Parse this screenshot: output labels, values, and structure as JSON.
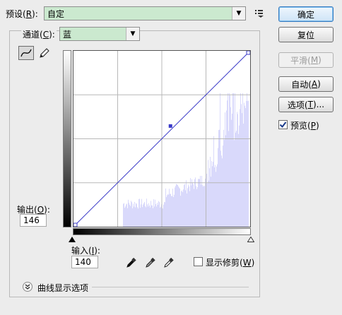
{
  "preset": {
    "label": "预设(",
    "key": "R",
    "suffix": "):",
    "value": "自定"
  },
  "channel": {
    "label": "通道(",
    "key": "C",
    "suffix": "):",
    "value": "蓝"
  },
  "output": {
    "label": "输出(",
    "key": "O",
    "suffix": "):",
    "value": "146"
  },
  "input": {
    "label": "输入(",
    "key": "I",
    "suffix": "):",
    "value": "140"
  },
  "buttons": {
    "ok": "确定",
    "reset": "复位",
    "smooth_pre": "平滑(",
    "smooth_key": "M",
    "smooth_post": ")",
    "auto_pre": "自动(",
    "auto_key": "A",
    "auto_post": ")",
    "options_pre": "选项(",
    "options_key": "T",
    "options_post": ")..."
  },
  "preview": {
    "label_pre": "预览(",
    "key": "P",
    "label_post": ")",
    "checked": true
  },
  "show_clipping": {
    "label_pre": "显示修剪(",
    "key": "W",
    "label_post": ")",
    "checked": false
  },
  "curve_display_options": "曲线显示选项",
  "curve": {
    "point": {
      "input": 140,
      "output": 146
    },
    "histogram_color": "#d9d9fb",
    "curve_color": "#3a3ac8"
  }
}
